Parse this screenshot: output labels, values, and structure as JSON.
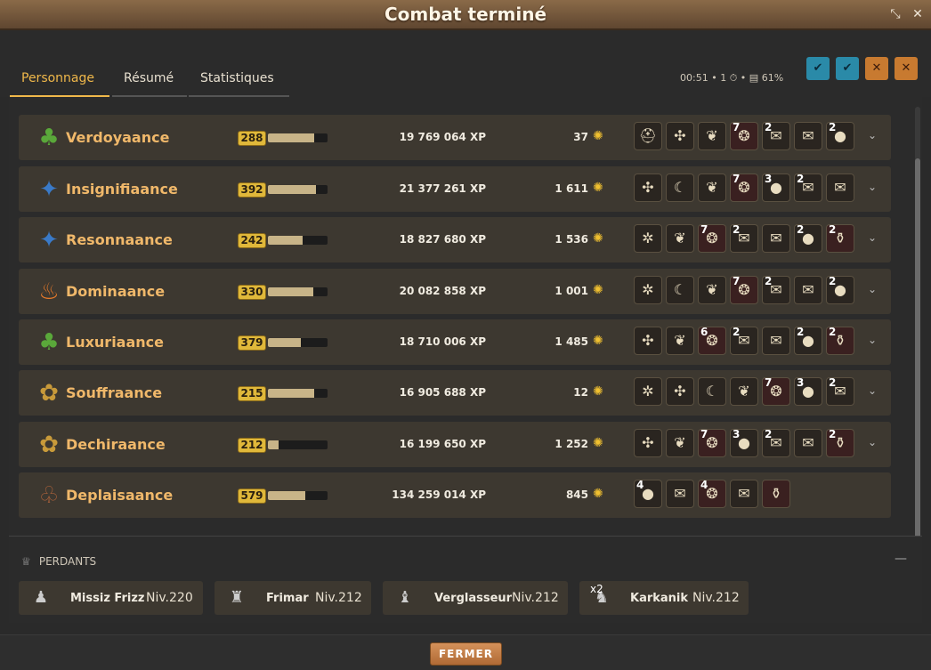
{
  "window": {
    "title": "Combat terminé"
  },
  "tabs": [
    {
      "label": "Personnage",
      "active": true
    },
    {
      "label": "Résumé",
      "active": false
    },
    {
      "label": "Statistiques",
      "active": false
    }
  ],
  "meta": {
    "duration": "00:51",
    "turns": "1",
    "separator": "•",
    "drop_percent": "61%"
  },
  "rows": [
    {
      "name": "Verdoyaance",
      "level": "288",
      "progress": 0.78,
      "xp": "19 769 064 XP",
      "kamas": "37",
      "items": [
        {
          "icon": "helmet",
          "qty": ""
        },
        {
          "icon": "bone",
          "qty": ""
        },
        {
          "icon": "plant",
          "qty": ""
        },
        {
          "icon": "meat",
          "qty": "7"
        },
        {
          "icon": "scroll",
          "qty": "2"
        },
        {
          "icon": "scroll",
          "qty": ""
        },
        {
          "icon": "orb",
          "qty": "2"
        }
      ]
    },
    {
      "name": "Insignifiaance",
      "level": "392",
      "progress": 0.8,
      "xp": "21 377 261 XP",
      "kamas": "1 611",
      "items": [
        {
          "icon": "bone",
          "qty": ""
        },
        {
          "icon": "horn",
          "qty": ""
        },
        {
          "icon": "plant",
          "qty": ""
        },
        {
          "icon": "meat",
          "qty": "7"
        },
        {
          "icon": "orb",
          "qty": "3"
        },
        {
          "icon": "scroll",
          "qty": "2"
        },
        {
          "icon": "scroll",
          "qty": ""
        }
      ]
    },
    {
      "name": "Resonnaance",
      "level": "242",
      "progress": 0.58,
      "xp": "18 827 680 XP",
      "kamas": "1 536",
      "items": [
        {
          "icon": "fish",
          "qty": ""
        },
        {
          "icon": "plant",
          "qty": ""
        },
        {
          "icon": "meat",
          "qty": "7"
        },
        {
          "icon": "scroll",
          "qty": "2"
        },
        {
          "icon": "scroll",
          "qty": ""
        },
        {
          "icon": "orb",
          "qty": "2"
        },
        {
          "icon": "potion",
          "qty": "2"
        }
      ]
    },
    {
      "name": "Dominaance",
      "level": "330",
      "progress": 0.76,
      "xp": "20 082 858 XP",
      "kamas": "1 001",
      "items": [
        {
          "icon": "fish",
          "qty": ""
        },
        {
          "icon": "horn",
          "qty": ""
        },
        {
          "icon": "plant",
          "qty": ""
        },
        {
          "icon": "meat",
          "qty": "7"
        },
        {
          "icon": "scroll",
          "qty": "2"
        },
        {
          "icon": "scroll",
          "qty": ""
        },
        {
          "icon": "orb",
          "qty": "2"
        }
      ]
    },
    {
      "name": "Luxuriaance",
      "level": "379",
      "progress": 0.55,
      "xp": "18 710 006 XP",
      "kamas": "1 485",
      "items": [
        {
          "icon": "bone",
          "qty": ""
        },
        {
          "icon": "plant",
          "qty": ""
        },
        {
          "icon": "meat",
          "qty": "6"
        },
        {
          "icon": "scroll",
          "qty": "2"
        },
        {
          "icon": "scroll",
          "qty": ""
        },
        {
          "icon": "orb",
          "qty": "2"
        },
        {
          "icon": "potion",
          "qty": "2"
        }
      ]
    },
    {
      "name": "Souffraance",
      "level": "215",
      "progress": 0.77,
      "xp": "16 905 688 XP",
      "kamas": "12",
      "items": [
        {
          "icon": "fish",
          "qty": ""
        },
        {
          "icon": "bone",
          "qty": ""
        },
        {
          "icon": "horn",
          "qty": ""
        },
        {
          "icon": "plant",
          "qty": ""
        },
        {
          "icon": "meat",
          "qty": "7"
        },
        {
          "icon": "orb",
          "qty": "3"
        },
        {
          "icon": "scroll",
          "qty": "2"
        }
      ]
    },
    {
      "name": "Dechiraance",
      "level": "212",
      "progress": 0.18,
      "xp": "16 199 650 XP",
      "kamas": "1 252",
      "items": [
        {
          "icon": "bone",
          "qty": ""
        },
        {
          "icon": "plant",
          "qty": ""
        },
        {
          "icon": "meat",
          "qty": "7"
        },
        {
          "icon": "orb",
          "qty": "3"
        },
        {
          "icon": "scroll",
          "qty": "2"
        },
        {
          "icon": "scroll",
          "qty": ""
        },
        {
          "icon": "potion",
          "qty": "2"
        }
      ]
    },
    {
      "name": "Deplaisaance",
      "level": "579",
      "progress": 0.62,
      "xp": "134 259 014 XP",
      "kamas": "845",
      "items": [
        {
          "icon": "orb",
          "qty": "4"
        },
        {
          "icon": "scroll",
          "qty": ""
        },
        {
          "icon": "meat",
          "qty": "4"
        },
        {
          "icon": "scroll",
          "qty": ""
        },
        {
          "icon": "potion",
          "qty": ""
        }
      ]
    }
  ],
  "losers": {
    "heading": "PERDANTS",
    "items": [
      {
        "name": "Missiz Frizz",
        "level": "Niv.220",
        "mult": ""
      },
      {
        "name": "Frimar",
        "level": "Niv.212",
        "mult": ""
      },
      {
        "name": "Verglasseur",
        "level": "Niv.212",
        "mult": ""
      },
      {
        "name": "Karkanik",
        "level": "Niv.212",
        "mult": "x2"
      }
    ]
  },
  "footer": {
    "close_label": "FERMER"
  },
  "colors": {
    "accent": "#f0b84a",
    "name": "#f0b86a",
    "level_badge": "#e0b83a"
  }
}
